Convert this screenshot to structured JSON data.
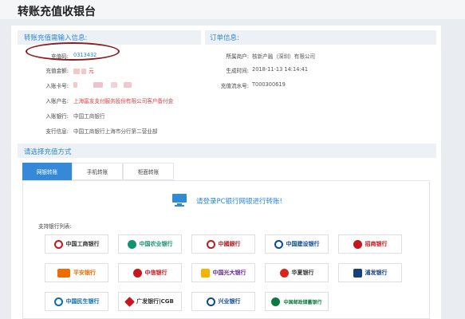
{
  "page_title": "转账充值收银台",
  "info": {
    "left_title": "转账充值需输入信息:",
    "right_title": "订单信息:",
    "left_rows": [
      {
        "label": "充值码:",
        "value": "0313432"
      },
      {
        "label": "充值金额:",
        "value": "元"
      },
      {
        "label": "入账卡号:",
        "value": ""
      },
      {
        "label": "入账户名:",
        "value": "上海富友支付服务股份有限公司客户备付金"
      },
      {
        "label": "入账银行:",
        "value": "中国工商银行"
      },
      {
        "label": "支行信息:",
        "value": "中国工商银行上海市分行第二营业部"
      }
    ],
    "right_rows": [
      {
        "label": "所属商户:",
        "value": "核新产融（深圳）有限公司"
      },
      {
        "label": "生成时间:",
        "value": "2018-11-13 14:14:41"
      },
      {
        "label": "充值流水号:",
        "value": "T000300619"
      }
    ]
  },
  "payment": {
    "title": "请选择充值方式",
    "tabs": [
      {
        "label": "网银转账",
        "active": true
      },
      {
        "label": "手机转账",
        "active": false
      },
      {
        "label": "柜面转账",
        "active": false
      }
    ],
    "login_text": "请登录PC银行网银进行转账!",
    "banks_label": "支持银行列表:",
    "banks": [
      {
        "name": "中国工商银行",
        "color": "#c7161e"
      },
      {
        "name": "中国农业银行",
        "color": "#139270"
      },
      {
        "name": "中國銀行",
        "color": "#b81c22"
      },
      {
        "name": "中国建设银行",
        "color": "#0a4a94"
      },
      {
        "name": "招商银行",
        "color": "#c4161c"
      },
      {
        "name": "平安银行",
        "color": "#ef6c00"
      },
      {
        "name": "中信银行",
        "color": "#c7161e"
      },
      {
        "name": "中国光大银行",
        "color": "#6a2c91"
      },
      {
        "name": "华夏银行",
        "color": "#d8261c"
      },
      {
        "name": "浦发银行",
        "color": "#183f7c"
      },
      {
        "name": "中国民生银行",
        "color": "#0a6bb0"
      },
      {
        "name": "广发银行|CGB",
        "color": "#c7161e"
      },
      {
        "name": "兴业银行",
        "color": "#0a4a94"
      },
      {
        "name": "中国邮政储蓄银行",
        "color": "#0b7a3e"
      }
    ]
  }
}
